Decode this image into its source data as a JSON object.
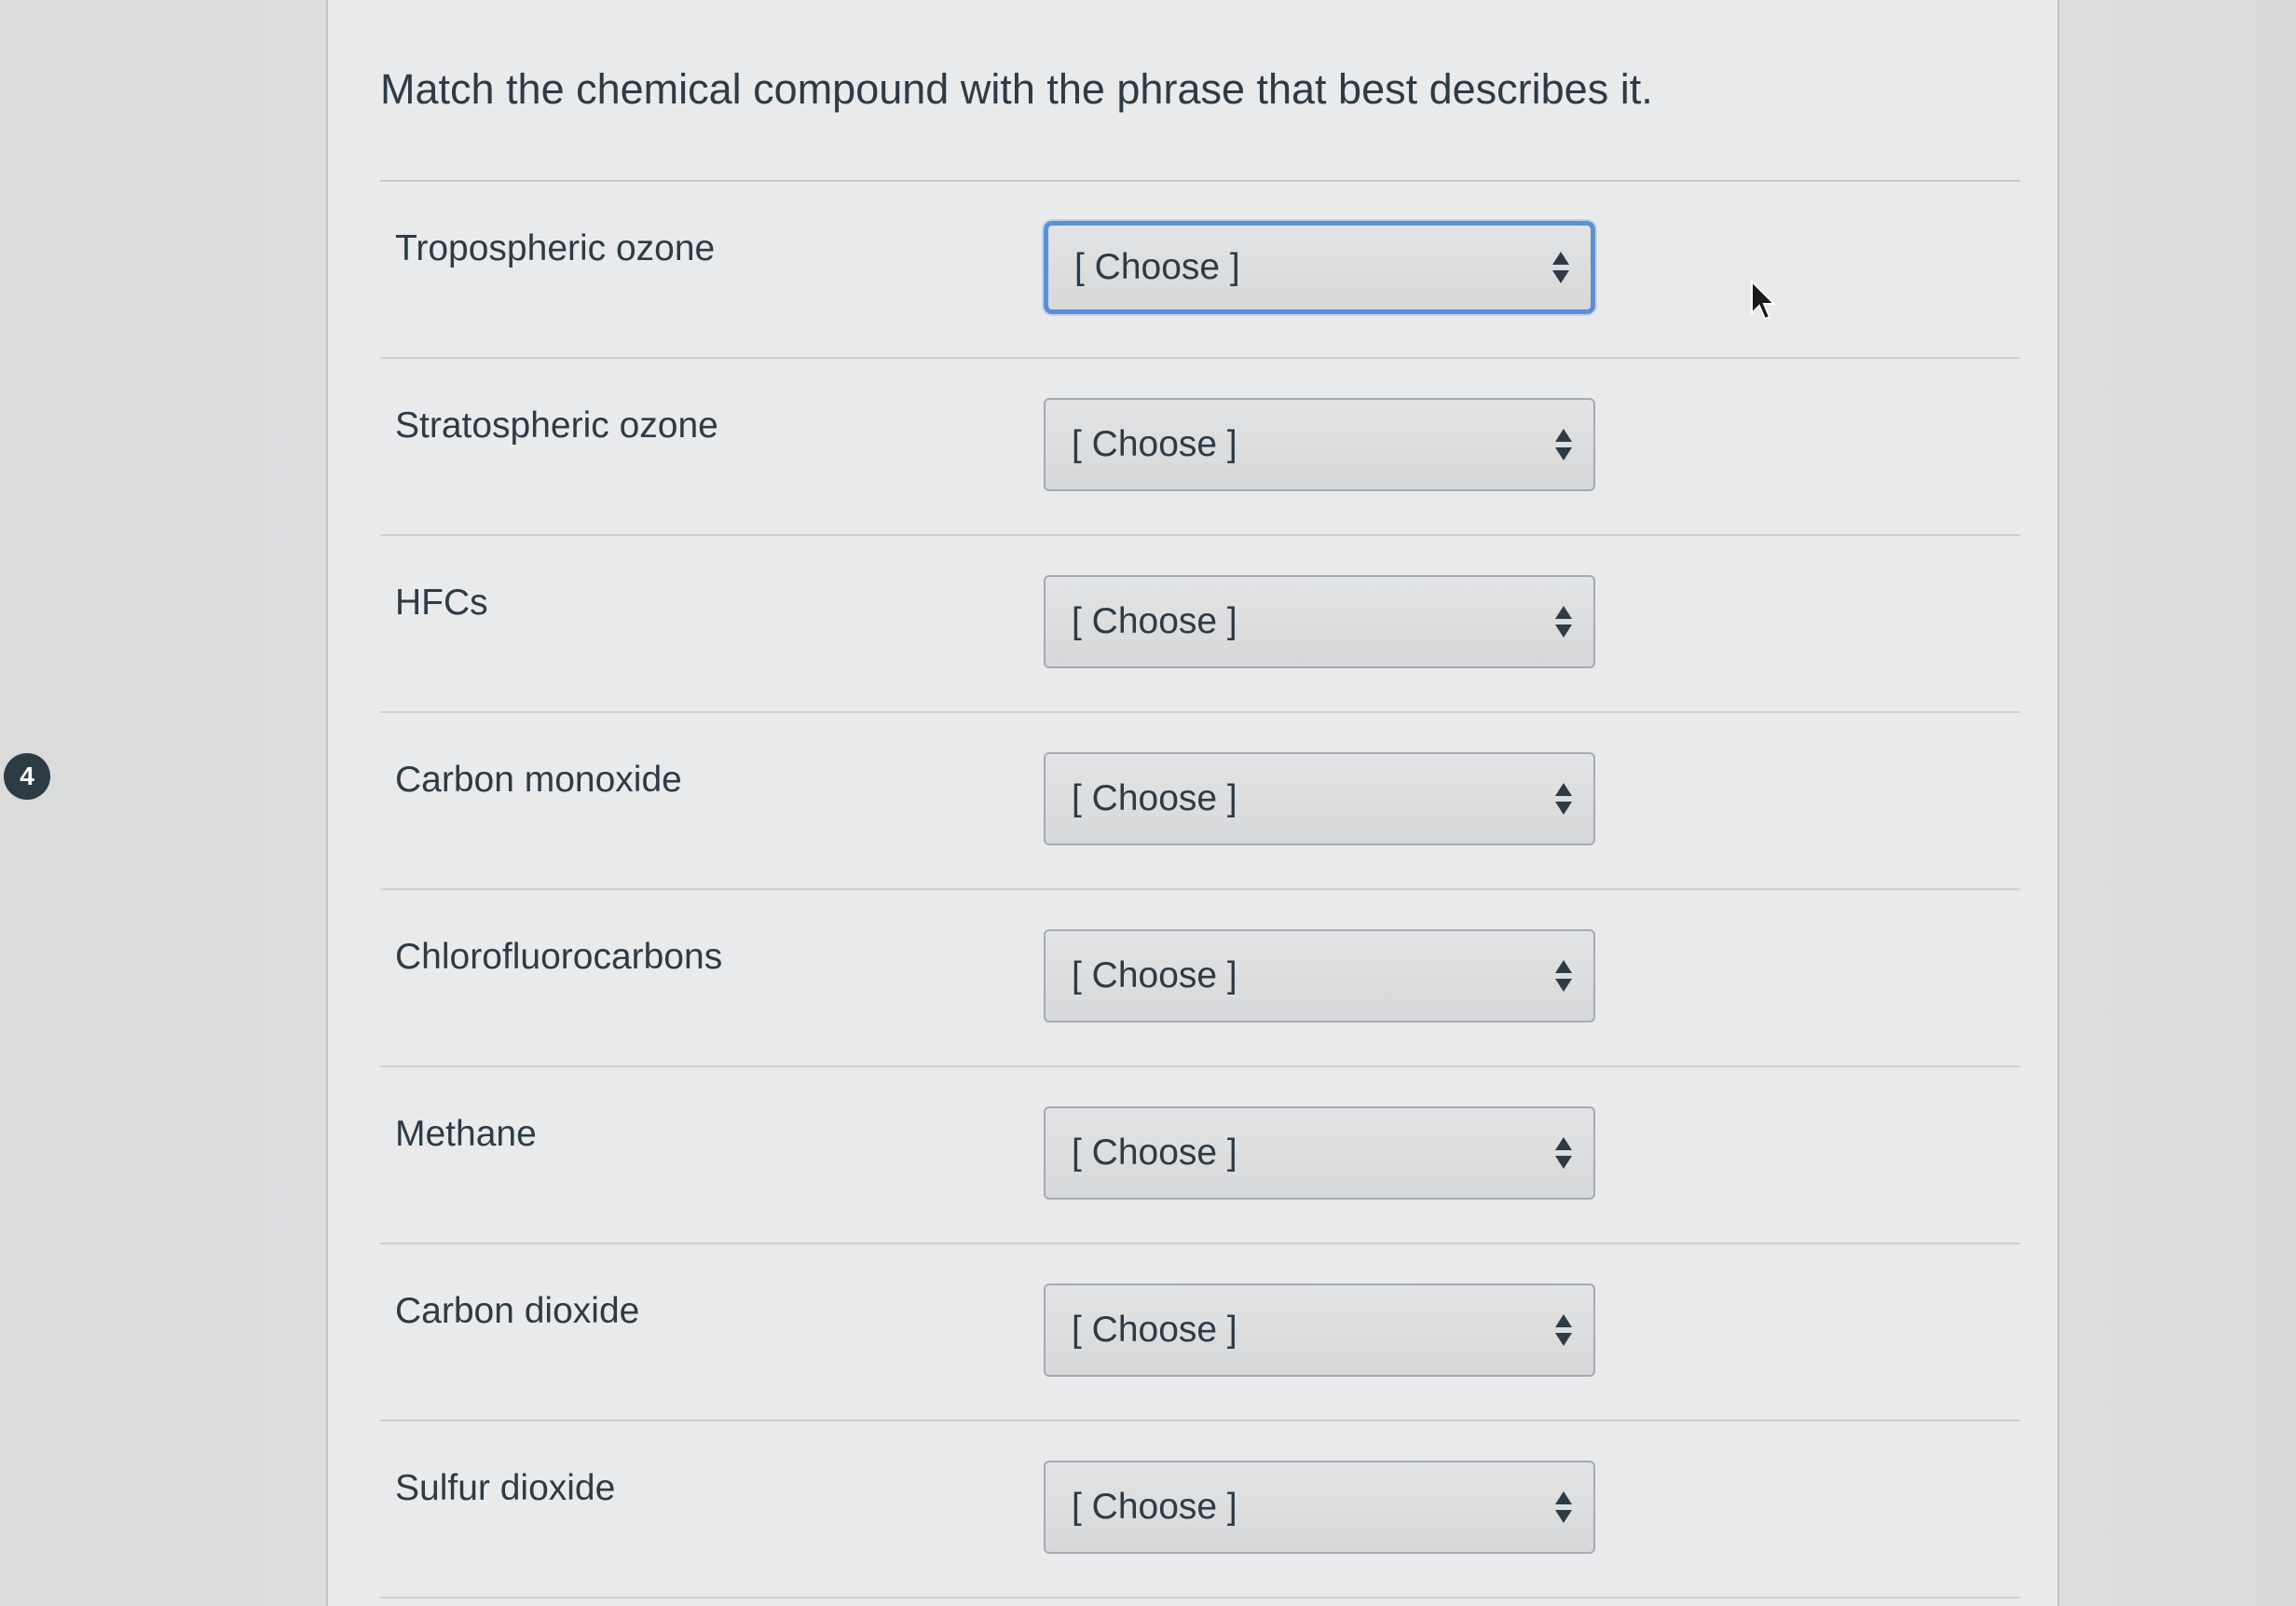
{
  "question": {
    "number": "4",
    "prompt": "Match the chemical compound with the phrase that best describes it."
  },
  "matches": [
    {
      "compound": "Tropospheric ozone",
      "selected": "[ Choose ]",
      "focused": true
    },
    {
      "compound": "Stratospheric ozone",
      "selected": "[ Choose ]",
      "focused": false
    },
    {
      "compound": "HFCs",
      "selected": "[ Choose ]",
      "focused": false
    },
    {
      "compound": "Carbon monoxide",
      "selected": "[ Choose ]",
      "focused": false
    },
    {
      "compound": "Chlorofluorocarbons",
      "selected": "[ Choose ]",
      "focused": false
    },
    {
      "compound": "Methane",
      "selected": "[ Choose ]",
      "focused": false
    },
    {
      "compound": "Carbon dioxide",
      "selected": "[ Choose ]",
      "focused": false
    },
    {
      "compound": "Sulfur dioxide",
      "selected": "[ Choose ]",
      "focused": false
    }
  ],
  "icons": {
    "select_arrow": "up-down-arrows-icon",
    "pointer": "mouse-cursor-icon"
  },
  "colors": {
    "text": "#2d3b45",
    "focus_border": "#5b8fd6",
    "badge": "#2d3b45"
  }
}
